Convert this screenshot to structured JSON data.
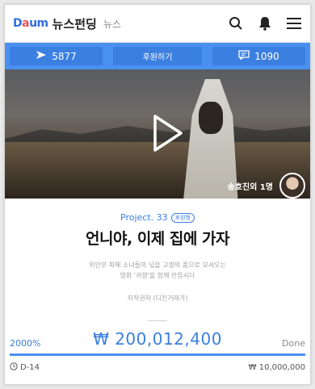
{
  "header": {
    "logo": [
      "D",
      "a",
      "u",
      "m"
    ],
    "service": "뉴스펀딩",
    "sub": "뉴스",
    "icons": [
      "search-icon",
      "bell-icon",
      "menu-icon"
    ]
  },
  "actions": {
    "share_count": "5877",
    "donate_label": "후원하기",
    "comment_count": "1090"
  },
  "video": {
    "supporters_text": "송호진외 1명"
  },
  "project": {
    "label": "Project. 33",
    "badge": "후원형",
    "title": "언니야, 이제 집에 가자",
    "desc_line1": "위안부 피해 소녀들의 넋을 고향의 품으로 모셔오는",
    "desc_line2": "영화 '귀향'을 함께 만듭시다",
    "author": "지작권자 (디진거래가)"
  },
  "funding": {
    "percent": "2000%",
    "amount": "₩ 200,012,400",
    "status": "Done",
    "progress": 1.0,
    "dday": "D-14",
    "goal": "₩ 10,000,000"
  },
  "colors": {
    "accent": "#4a90f0",
    "accent_dark": "#3b7fe0"
  }
}
